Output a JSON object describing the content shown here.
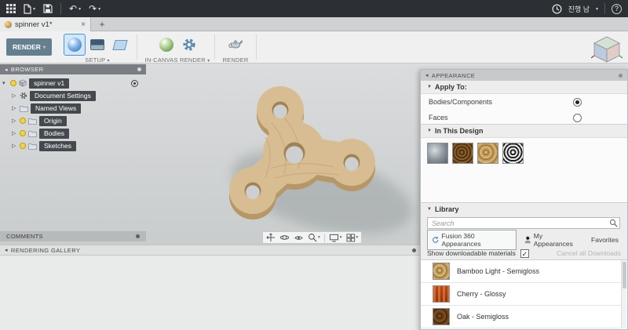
{
  "colors": {
    "accent_blue": "#3b97e3",
    "workspace_button": "#64808f",
    "wood_top": "#d9bd92",
    "wood_side": "#b69766",
    "topbar_bg": "#2c2f33"
  },
  "topbar": {
    "user_text": "진행 남"
  },
  "tabs": {
    "active_title": "spinner v1*",
    "close_glyph": "×",
    "new_tab_glyph": "+"
  },
  "toolbar": {
    "workspace": "RENDER",
    "groups": [
      {
        "label": "SETUP"
      },
      {
        "label": "IN-CANVAS RENDER"
      },
      {
        "label": "RENDER"
      }
    ]
  },
  "browser": {
    "header": "BROWSER",
    "root_label": "spinner v1",
    "items": [
      {
        "label": "Document Settings"
      },
      {
        "label": "Named Views"
      },
      {
        "label": "Origin"
      },
      {
        "label": "Bodies"
      },
      {
        "label": "Sketches"
      }
    ]
  },
  "comments": {
    "header": "COMMENTS"
  },
  "rendering_gallery": {
    "header": "RENDERING GALLERY"
  },
  "appearance": {
    "header": "APPEARANCE",
    "apply_to_title": "Apply To:",
    "apply_options": [
      {
        "label": "Bodies/Components",
        "selected": true
      },
      {
        "label": "Faces",
        "selected": false
      }
    ],
    "in_this_design_title": "In This Design",
    "design_swatches": [
      "steel-gray",
      "walnut-rings",
      "bamboo-rings",
      "zebra-rings"
    ],
    "library_title": "Library",
    "search_placeholder": "Search",
    "tabs": [
      {
        "label": "Fusion 360 Appearances",
        "active": true
      },
      {
        "label": "My Appearances",
        "active": false
      },
      {
        "label": "Favorites",
        "active": false
      }
    ],
    "show_downloadable_label": "Show downloadable materials",
    "show_downloadable_checked": true,
    "cancel_downloads_label": "Cancel all Downloads",
    "materials": [
      {
        "name": "Bamboo Light - Semigloss"
      },
      {
        "name": "Cherry - Glossy"
      },
      {
        "name": "Oak - Semigloss"
      }
    ]
  }
}
